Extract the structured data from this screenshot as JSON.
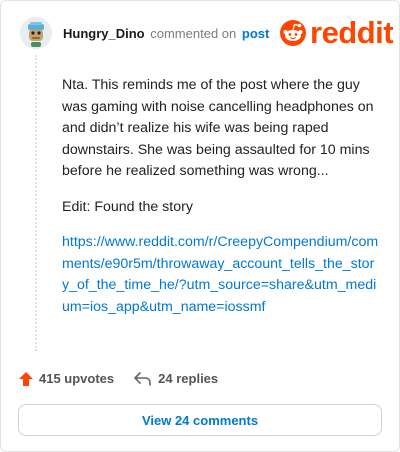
{
  "header": {
    "username": "Hungry_Dino",
    "action_text": "commented on",
    "post_link": "post",
    "logo_text": "reddit"
  },
  "comment": {
    "paragraph1": "Nta. This reminds me of the post where the guy was gaming with noise cancelling headphones on and didn’t realize his wife was being raped downstairs. She was being assaulted for 10 mins before he realized something was wrong...",
    "paragraph2": "Edit: Found the story",
    "link": "https://www.reddit.com/r/CreepyCompendium/comments/e90r5m/throwaway_account_tells_the_story_of_the_time_he/?utm_source=share&utm_medium=ios_app&utm_name=iossmf"
  },
  "footer": {
    "upvotes": "415 upvotes",
    "replies": "24 replies",
    "view_comments": "View 24 comments"
  },
  "colors": {
    "brand": "#ff4500",
    "link": "#0079d3"
  }
}
